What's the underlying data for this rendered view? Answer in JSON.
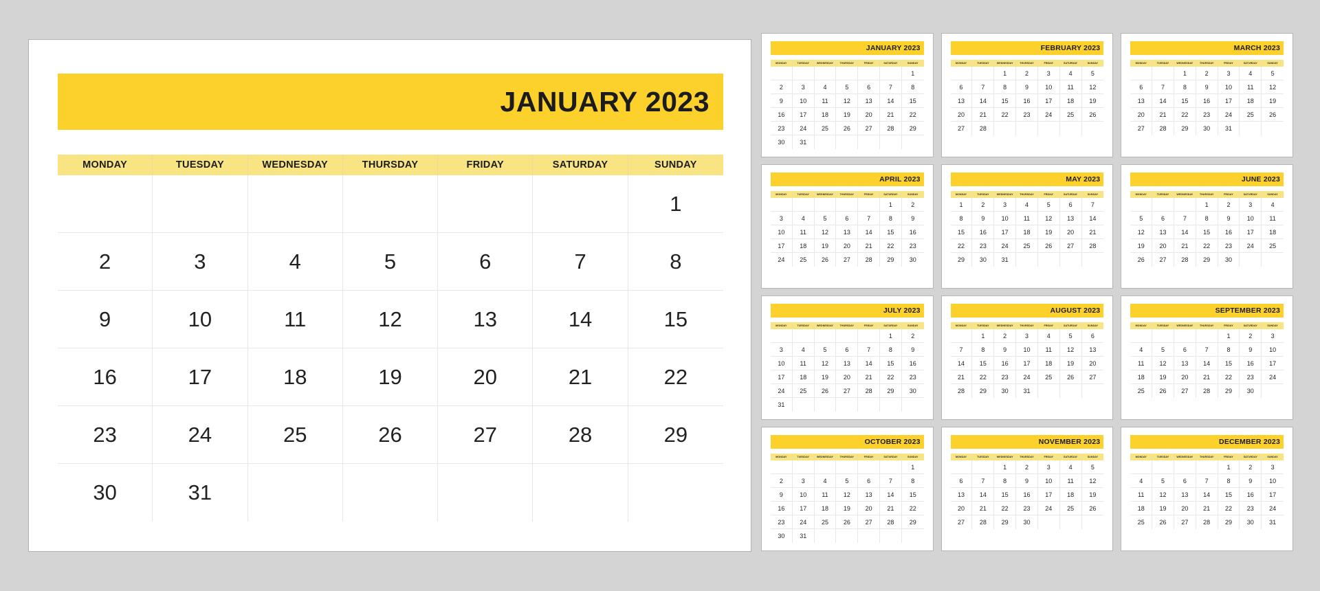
{
  "theme": {
    "page_background": "#d4d4d4",
    "accent_yellow": "#fcd12c",
    "weekday_yellow": "#f8e483",
    "text_color": "#1c1c1c",
    "panel_background": "#ffffff"
  },
  "year": "2023",
  "main_calendar": {
    "title": "JANUARY 2023",
    "month_name": "JANUARY",
    "weekdays": [
      "MONDAY",
      "TUESDAY",
      "WEDNESDAY",
      "THURSDAY",
      "FRIDAY",
      "SATURDAY",
      "SUNDAY"
    ],
    "weeks": [
      [
        "",
        "",
        "",
        "",
        "",
        "",
        "1"
      ],
      [
        "2",
        "3",
        "4",
        "5",
        "6",
        "7",
        "8"
      ],
      [
        "9",
        "10",
        "11",
        "12",
        "13",
        "14",
        "15"
      ],
      [
        "16",
        "17",
        "18",
        "19",
        "20",
        "21",
        "22"
      ],
      [
        "23",
        "24",
        "25",
        "26",
        "27",
        "28",
        "29"
      ],
      [
        "30",
        "31",
        "",
        "",
        "",
        "",
        ""
      ]
    ]
  },
  "mini_weekdays": [
    "MONDAY",
    "TUESDAY",
    "WEDNESDAY",
    "THURSDAY",
    "FRIDAY",
    "SATURDAY",
    "SUNDAY"
  ],
  "mini_calendars": [
    {
      "title": "JANUARY 2023",
      "month_name": "JANUARY",
      "weeks": [
        [
          "",
          "",
          "",
          "",
          "",
          "",
          "1"
        ],
        [
          "2",
          "3",
          "4",
          "5",
          "6",
          "7",
          "8"
        ],
        [
          "9",
          "10",
          "11",
          "12",
          "13",
          "14",
          "15"
        ],
        [
          "16",
          "17",
          "18",
          "19",
          "20",
          "21",
          "22"
        ],
        [
          "23",
          "24",
          "25",
          "26",
          "27",
          "28",
          "29"
        ],
        [
          "30",
          "31",
          "",
          "",
          "",
          "",
          ""
        ]
      ]
    },
    {
      "title": "FEBRUARY 2023",
      "month_name": "FEBRUARY",
      "weeks": [
        [
          "",
          "",
          "1",
          "2",
          "3",
          "4",
          "5"
        ],
        [
          "6",
          "7",
          "8",
          "9",
          "10",
          "11",
          "12"
        ],
        [
          "13",
          "14",
          "15",
          "16",
          "17",
          "18",
          "19"
        ],
        [
          "20",
          "21",
          "22",
          "23",
          "24",
          "25",
          "26"
        ],
        [
          "27",
          "28",
          "",
          "",
          "",
          "",
          ""
        ]
      ]
    },
    {
      "title": "MARCH 2023",
      "month_name": "MARCH",
      "weeks": [
        [
          "",
          "",
          "1",
          "2",
          "3",
          "4",
          "5"
        ],
        [
          "6",
          "7",
          "8",
          "9",
          "10",
          "11",
          "12"
        ],
        [
          "13",
          "14",
          "15",
          "16",
          "17",
          "18",
          "19"
        ],
        [
          "20",
          "21",
          "22",
          "23",
          "24",
          "25",
          "26"
        ],
        [
          "27",
          "28",
          "29",
          "30",
          "31",
          "",
          ""
        ]
      ]
    },
    {
      "title": "APRIL 2023",
      "month_name": "APRIL",
      "weeks": [
        [
          "",
          "",
          "",
          "",
          "",
          "1",
          "2"
        ],
        [
          "3",
          "4",
          "5",
          "6",
          "7",
          "8",
          "9"
        ],
        [
          "10",
          "11",
          "12",
          "13",
          "14",
          "15",
          "16"
        ],
        [
          "17",
          "18",
          "19",
          "20",
          "21",
          "22",
          "23"
        ],
        [
          "24",
          "25",
          "26",
          "27",
          "28",
          "29",
          "30"
        ]
      ]
    },
    {
      "title": "MAY 2023",
      "month_name": "MAY",
      "weeks": [
        [
          "1",
          "2",
          "3",
          "4",
          "5",
          "6",
          "7"
        ],
        [
          "8",
          "9",
          "10",
          "11",
          "12",
          "13",
          "14"
        ],
        [
          "15",
          "16",
          "17",
          "18",
          "19",
          "20",
          "21"
        ],
        [
          "22",
          "23",
          "24",
          "25",
          "26",
          "27",
          "28"
        ],
        [
          "29",
          "30",
          "31",
          "",
          "",
          "",
          ""
        ]
      ]
    },
    {
      "title": "JUNE 2023",
      "month_name": "JUNE",
      "weeks": [
        [
          "",
          "",
          "",
          "1",
          "2",
          "3",
          "4"
        ],
        [
          "5",
          "6",
          "7",
          "8",
          "9",
          "10",
          "11"
        ],
        [
          "12",
          "13",
          "14",
          "15",
          "16",
          "17",
          "18"
        ],
        [
          "19",
          "20",
          "21",
          "22",
          "23",
          "24",
          "25"
        ],
        [
          "26",
          "27",
          "28",
          "29",
          "30",
          "",
          ""
        ]
      ]
    },
    {
      "title": "JULY 2023",
      "month_name": "JULY",
      "weeks": [
        [
          "",
          "",
          "",
          "",
          "",
          "1",
          "2"
        ],
        [
          "3",
          "4",
          "5",
          "6",
          "7",
          "8",
          "9"
        ],
        [
          "10",
          "11",
          "12",
          "13",
          "14",
          "15",
          "16"
        ],
        [
          "17",
          "18",
          "19",
          "20",
          "21",
          "22",
          "23"
        ],
        [
          "24",
          "25",
          "26",
          "27",
          "28",
          "29",
          "30"
        ],
        [
          "31",
          "",
          "",
          "",
          "",
          "",
          ""
        ]
      ]
    },
    {
      "title": "AUGUST 2023",
      "month_name": "AUGUST",
      "weeks": [
        [
          "",
          "1",
          "2",
          "3",
          "4",
          "5",
          "6"
        ],
        [
          "7",
          "8",
          "9",
          "10",
          "11",
          "12",
          "13"
        ],
        [
          "14",
          "15",
          "16",
          "17",
          "18",
          "19",
          "20"
        ],
        [
          "21",
          "22",
          "23",
          "24",
          "25",
          "26",
          "27"
        ],
        [
          "28",
          "29",
          "30",
          "31",
          "",
          "",
          ""
        ]
      ]
    },
    {
      "title": "SEPTEMBER 2023",
      "month_name": "SEPTEMBER",
      "weeks": [
        [
          "",
          "",
          "",
          "",
          "1",
          "2",
          "3"
        ],
        [
          "4",
          "5",
          "6",
          "7",
          "8",
          "9",
          "10"
        ],
        [
          "11",
          "12",
          "13",
          "14",
          "15",
          "16",
          "17"
        ],
        [
          "18",
          "19",
          "20",
          "21",
          "22",
          "23",
          "24"
        ],
        [
          "25",
          "26",
          "27",
          "28",
          "29",
          "30",
          ""
        ]
      ]
    },
    {
      "title": "OCTOBER 2023",
      "month_name": "OCTOBER",
      "weeks": [
        [
          "",
          "",
          "",
          "",
          "",
          "",
          "1"
        ],
        [
          "2",
          "3",
          "4",
          "5",
          "6",
          "7",
          "8"
        ],
        [
          "9",
          "10",
          "11",
          "12",
          "13",
          "14",
          "15"
        ],
        [
          "16",
          "17",
          "18",
          "19",
          "20",
          "21",
          "22"
        ],
        [
          "23",
          "24",
          "25",
          "26",
          "27",
          "28",
          "29"
        ],
        [
          "30",
          "31",
          "",
          "",
          "",
          "",
          ""
        ]
      ]
    },
    {
      "title": "NOVEMBER 2023",
      "month_name": "NOVEMBER",
      "weeks": [
        [
          "",
          "",
          "1",
          "2",
          "3",
          "4",
          "5"
        ],
        [
          "6",
          "7",
          "8",
          "9",
          "10",
          "11",
          "12"
        ],
        [
          "13",
          "14",
          "15",
          "16",
          "17",
          "18",
          "19"
        ],
        [
          "20",
          "21",
          "22",
          "23",
          "24",
          "25",
          "26"
        ],
        [
          "27",
          "28",
          "29",
          "30",
          "",
          "",
          ""
        ]
      ]
    },
    {
      "title": "DECEMBER 2023",
      "month_name": "DECEMBER",
      "weeks": [
        [
          "",
          "",
          "",
          "",
          "1",
          "2",
          "3"
        ],
        [
          "4",
          "5",
          "6",
          "7",
          "8",
          "9",
          "10"
        ],
        [
          "11",
          "12",
          "13",
          "14",
          "15",
          "16",
          "17"
        ],
        [
          "18",
          "19",
          "20",
          "21",
          "22",
          "23",
          "24"
        ],
        [
          "25",
          "26",
          "27",
          "28",
          "29",
          "30",
          "31"
        ]
      ]
    }
  ]
}
